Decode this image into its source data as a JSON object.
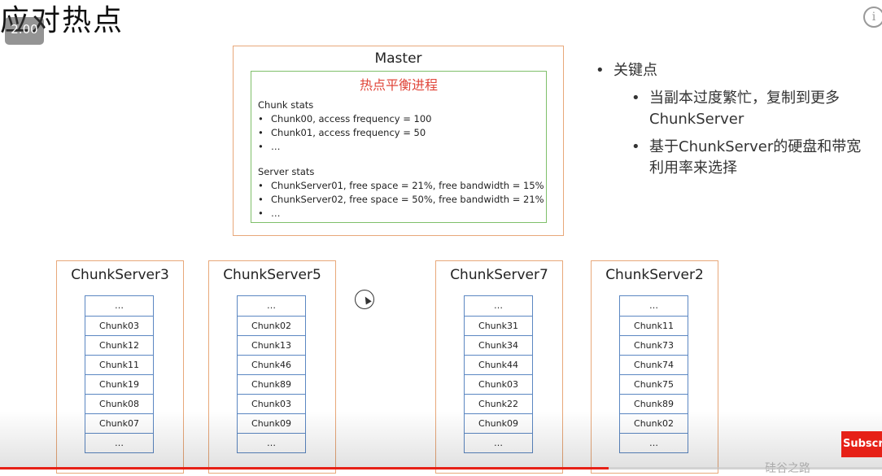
{
  "slide": {
    "title": "应对热点"
  },
  "player": {
    "speed_label": "2.00",
    "info_icon": "info-icon",
    "subscribe_label": "Subscribe",
    "watermark": "硅谷之路",
    "progress_fraction": 0.69
  },
  "master": {
    "title": "Master",
    "balance_title": "热点平衡进程",
    "chunk_stats_header": "Chunk stats",
    "chunk_stats": [
      "Chunk00, access frequency = 100",
      "Chunk01, access frequency = 50",
      "…"
    ],
    "server_stats_header": "Server stats",
    "server_stats": [
      "ChunkServer01, free space = 21%, free bandwidth = 15%",
      "ChunkServer02, free space = 50%, free bandwidth = 21%",
      "…"
    ]
  },
  "key_points": {
    "header": "关键点",
    "items": [
      "当副本过度繁忙，复制到更多ChunkServer",
      "基于ChunkServer的硬盘和带宽利用率来选择"
    ]
  },
  "servers": [
    {
      "name": "ChunkServer3",
      "chunks": [
        "…",
        "Chunk03",
        "Chunk12",
        "Chunk11",
        "Chunk19",
        "Chunk08",
        "Chunk07",
        "…"
      ]
    },
    {
      "name": "ChunkServer5",
      "chunks": [
        "…",
        "Chunk02",
        "Chunk13",
        "Chunk46",
        "Chunk89",
        "Chunk03",
        "Chunk09",
        "…"
      ]
    },
    {
      "name": "ChunkServer7",
      "chunks": [
        "…",
        "Chunk31",
        "Chunk34",
        "Chunk44",
        "Chunk03",
        "Chunk22",
        "Chunk09",
        "…"
      ]
    },
    {
      "name": "ChunkServer2",
      "chunks": [
        "…",
        "Chunk11",
        "Chunk73",
        "Chunk74",
        "Chunk75",
        "Chunk89",
        "Chunk02",
        "…"
      ]
    }
  ]
}
